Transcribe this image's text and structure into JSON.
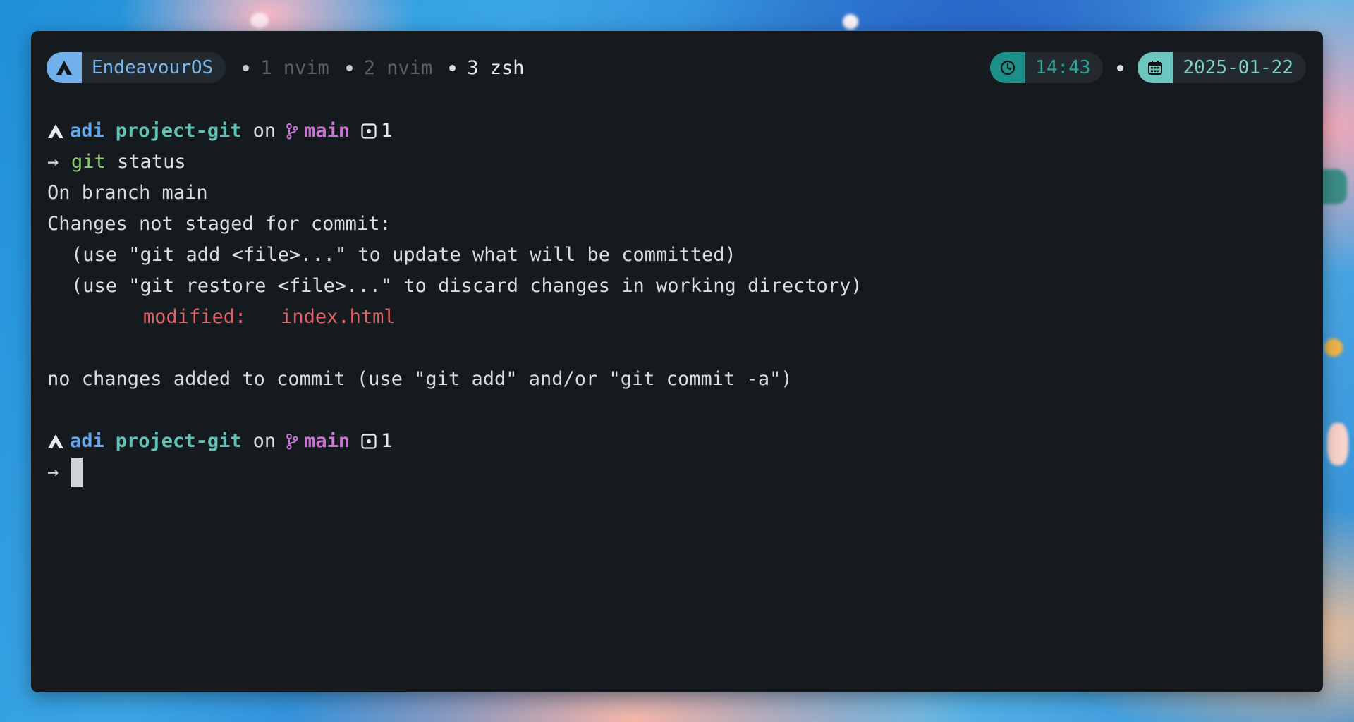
{
  "status_bar": {
    "os_name": "EndeavourOS",
    "tabs": [
      {
        "label": "1 nvim",
        "active": false
      },
      {
        "label": "2 nvim",
        "active": false
      },
      {
        "label": "3 zsh",
        "active": true
      }
    ],
    "time": "14:43",
    "date": "2025-01-22"
  },
  "prompt": {
    "user": "adi",
    "directory": "project-git",
    "on_word": "on",
    "branch": "main",
    "stash_count": "1"
  },
  "command": {
    "program": "git",
    "args": "status"
  },
  "output": {
    "line1": "On branch main",
    "line2": "Changes not staged for commit:",
    "line3": "(use \"git add <file>...\" to update what will be committed)",
    "line4": "(use \"git restore <file>...\" to discard changes in working directory)",
    "modified_label": "modified:",
    "modified_file": "index.html",
    "line6": "no changes added to commit (use \"git add\" and/or \"git commit -a\")"
  },
  "icons": {
    "os": "endeavouros-icon",
    "clock": "clock-icon",
    "calendar": "calendar-icon",
    "branch": "git-branch-icon",
    "stash": "stash-icon",
    "prompt": "endeavouros-prompt-icon"
  },
  "colors": {
    "terminal_bg": "#151a1e",
    "user": "#67a9ee",
    "directory": "#63c2b8",
    "branch": "#c875d6",
    "git_cmd": "#8bc86a",
    "modified": "#e06468"
  }
}
